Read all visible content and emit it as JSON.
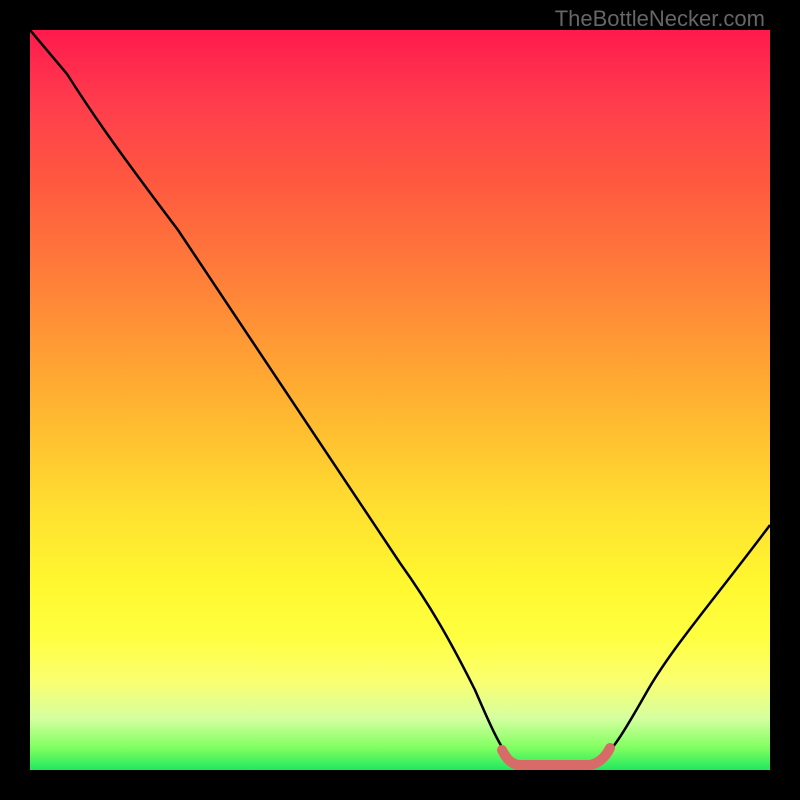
{
  "attribution": "TheBottleNecker.com",
  "chart_data": {
    "type": "line",
    "title": "",
    "xlabel": "",
    "ylabel": "",
    "xlim": [
      0,
      100
    ],
    "ylim": [
      0,
      100
    ],
    "background_gradient": {
      "top": "#ff1a4d",
      "bottom": "#20e860",
      "description": "red-orange-yellow-green vertical gradient"
    },
    "series": [
      {
        "name": "bottleneck-curve",
        "color": "#000000",
        "x": [
          0,
          5,
          10,
          20,
          30,
          40,
          50,
          58,
          62,
          68,
          72,
          78,
          85,
          92,
          100
        ],
        "y": [
          100,
          94,
          87,
          73,
          58,
          43,
          28,
          14,
          6,
          1,
          0.5,
          1,
          8,
          18,
          33
        ]
      },
      {
        "name": "optimal-zone",
        "color": "#d86a68",
        "type": "highlight",
        "x_range": [
          62,
          78
        ],
        "y": 0.5
      }
    ],
    "annotations": []
  }
}
